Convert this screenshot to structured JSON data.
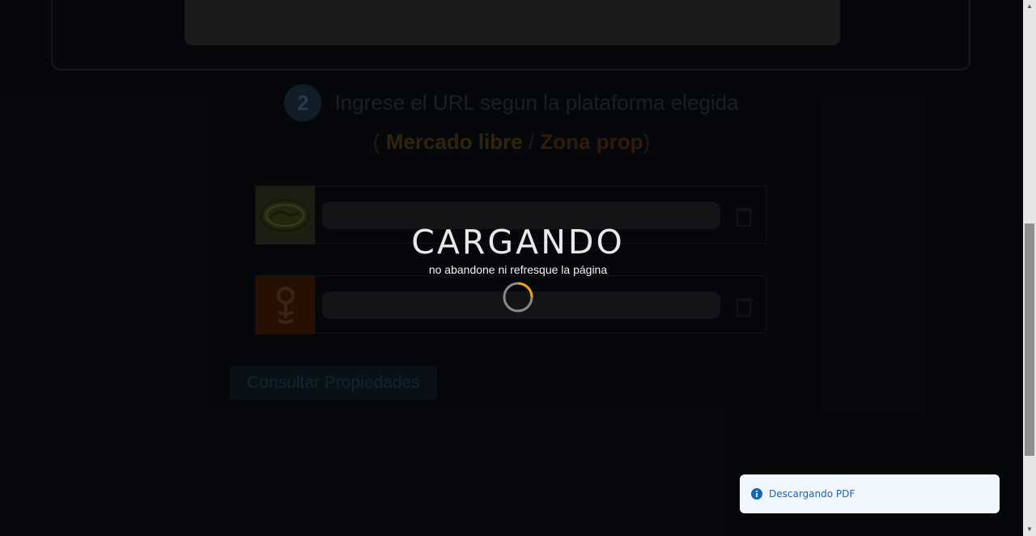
{
  "step": {
    "number": "2",
    "instruction": "Ingrese el URL segun la plataforma elegida",
    "platform_open": "( ",
    "platform_ml": "Mercado libre",
    "platform_sep": " / ",
    "platform_zp": "Zona prop",
    "platform_close": ")"
  },
  "actions": {
    "consult_label": "Consultar Propiedades"
  },
  "loader": {
    "title": "CARGANDO",
    "subtitle": "no abandone ni refresque la página"
  },
  "toast": {
    "message": "Descargando PDF",
    "icon": "info-icon"
  },
  "colors": {
    "spinner_accent": "#f0a020",
    "toast_text": "#1764b8"
  }
}
